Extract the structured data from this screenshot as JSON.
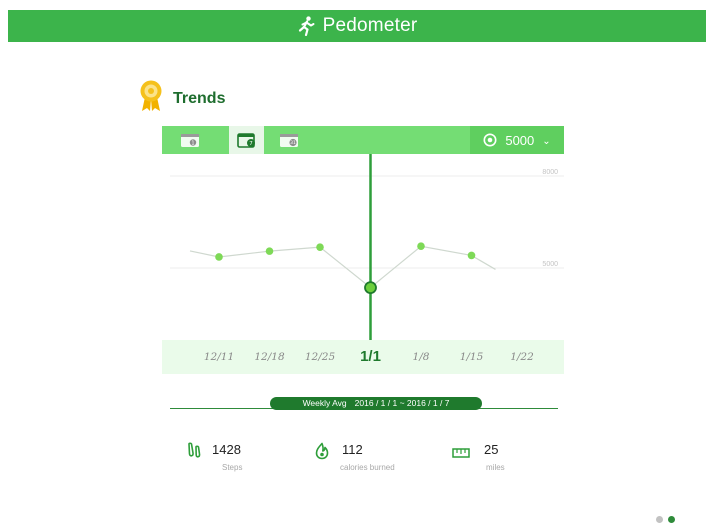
{
  "header": {
    "title": "Pedometer",
    "icon": "runner-icon",
    "color": "#3cb44b"
  },
  "section": {
    "title": "Trends",
    "icon": "award-ribbon-icon"
  },
  "toolbar": {
    "tabs": [
      {
        "icon": "calendar-day-icon",
        "badge": "1",
        "selected": false
      },
      {
        "icon": "calendar-week-icon",
        "badge": "7",
        "selected": true
      },
      {
        "icon": "calendar-month-icon",
        "badge": "31",
        "selected": false
      }
    ],
    "goal": {
      "icon": "target-icon",
      "value": "5000",
      "arrow": "⌄"
    }
  },
  "chart_data": {
    "type": "line",
    "x": [
      "12/11",
      "12/18",
      "12/25",
      "1/1",
      "1/8",
      "1/15",
      "1/22"
    ],
    "values": [
      5360,
      5550,
      5680,
      4360,
      5710,
      5410
    ],
    "y_ticks": [
      "8000",
      "5000"
    ],
    "selected": "1/1",
    "grid": true,
    "colors": {
      "point": "#7ed957",
      "line": "#cfd8cf",
      "cursor": "#2e9e3a",
      "selected_fill": "#6ccf3c"
    }
  },
  "weekly": {
    "label": "Weekly Avg",
    "range": "2016 / 1 / 1 ~ 2016 / 1 / 7"
  },
  "stats": [
    {
      "icon": "footprint-icon",
      "value": "1428",
      "label": "Steps"
    },
    {
      "icon": "flame-icon",
      "value": "112",
      "label": "calories burned"
    },
    {
      "icon": "ruler-icon",
      "value": "25",
      "label": "miles"
    }
  ],
  "pagination": {
    "total": 2,
    "current": 2,
    "colors": [
      "#c2c2c2",
      "#2e8b3a"
    ]
  }
}
